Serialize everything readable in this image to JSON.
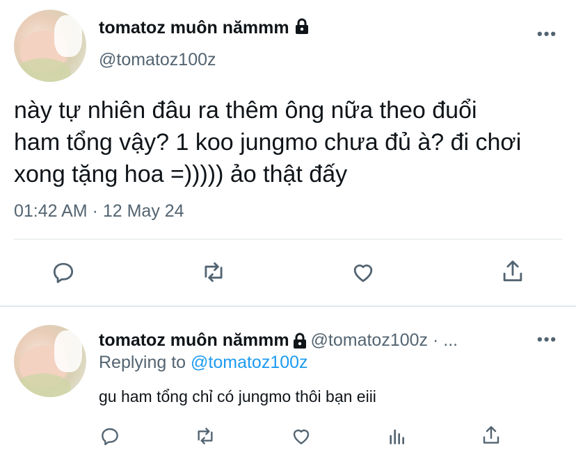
{
  "main_tweet": {
    "display_name": "tomatoz muôn nămmm",
    "handle": "@tomatoz100z",
    "text_lines": [
      "này tự nhiên đâu ra thêm ông nữa theo đuổi",
      "ham tổng vậy? 1 koo jungmo chưa đủ à? đi chơi",
      "xong tặng hoa =))))) ảo thật đấy"
    ],
    "timestamp": "01:42 AM · 12 May 24"
  },
  "reply_tweet": {
    "display_name": "tomatoz muôn nămmm",
    "handle_time": "@tomatoz100z · ...",
    "replying_prefix": "Replying to ",
    "replying_handle": "@tomatoz100z",
    "text": "gu ham tổng chỉ có jungmo thôi bạn eiii"
  },
  "more_label": "•••",
  "colors": {
    "accent": "#1d9bf0",
    "secondary": "#536471",
    "divider": "#e1e6ea"
  },
  "icons": [
    "lock-icon",
    "reply-icon",
    "retweet-icon",
    "like-icon",
    "share-icon",
    "views-icon",
    "more-icon"
  ]
}
